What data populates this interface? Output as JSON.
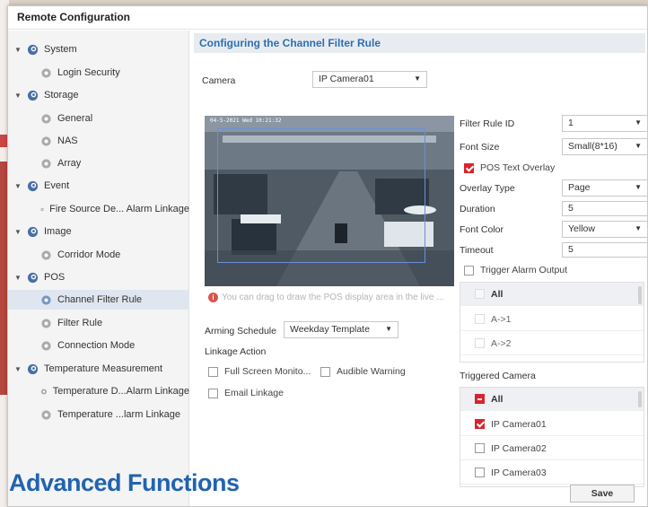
{
  "window": {
    "title": "Remote Configuration"
  },
  "sidebar": {
    "items": [
      {
        "label": "System",
        "level": 0,
        "expanded": true,
        "icon": "gear-group-icon"
      },
      {
        "label": "Login Security",
        "level": 1,
        "icon": "gear-icon"
      },
      {
        "label": "Storage",
        "level": 0,
        "expanded": true,
        "icon": "gear-group-icon"
      },
      {
        "label": "General",
        "level": 1,
        "icon": "gear-icon"
      },
      {
        "label": "NAS",
        "level": 1,
        "icon": "gear-icon"
      },
      {
        "label": "Array",
        "level": 1,
        "icon": "gear-icon"
      },
      {
        "label": "Event",
        "level": 0,
        "expanded": true,
        "icon": "gear-group-icon"
      },
      {
        "label": "Fire Source De... Alarm Linkage",
        "level": 1,
        "icon": "gear-icon"
      },
      {
        "label": "Image",
        "level": 0,
        "expanded": true,
        "icon": "gear-group-icon"
      },
      {
        "label": "Corridor Mode",
        "level": 1,
        "icon": "gear-icon"
      },
      {
        "label": "POS",
        "level": 0,
        "expanded": true,
        "icon": "gear-group-icon"
      },
      {
        "label": "Channel Filter Rule",
        "level": 1,
        "selected": true,
        "icon": "gear-icon"
      },
      {
        "label": "Filter Rule",
        "level": 1,
        "icon": "gear-icon"
      },
      {
        "label": "Connection Mode",
        "level": 1,
        "icon": "gear-icon"
      },
      {
        "label": "Temperature Measurement",
        "level": 0,
        "expanded": true,
        "icon": "gear-group-icon"
      },
      {
        "label": "Temperature D...Alarm Linkage",
        "level": 1,
        "icon": "gear-icon"
      },
      {
        "label": "Temperature ...larm Linkage",
        "level": 1,
        "icon": "gear-icon"
      }
    ]
  },
  "main": {
    "section_title": "Configuring the Channel Filter Rule",
    "camera_label": "Camera",
    "camera_value": "IP Camera01",
    "video_osd": "04-5-2021 Wed 10:21:32",
    "draw_hint": "You can drag to draw the POS display area in the live ...",
    "arming_schedule_label": "Arming Schedule",
    "arming_schedule_value": "Weekday Template",
    "linkage_action_label": "Linkage Action",
    "linkage": {
      "full_screen": "Full Screen Monito...",
      "audible_warning": "Audible Warning",
      "email_linkage": "Email Linkage"
    },
    "settings": {
      "filter_rule_id_label": "Filter Rule ID",
      "filter_rule_id_value": "1",
      "font_size_label": "Font Size",
      "font_size_value": "Small(8*16)",
      "pos_text_overlay_label": "POS Text Overlay",
      "pos_text_overlay_checked": true,
      "overlay_type_label": "Overlay Type",
      "overlay_type_value": "Page",
      "duration_label": "Duration",
      "duration_value": "5",
      "font_color_label": "Font Color",
      "font_color_value": "Yellow",
      "timeout_label": "Timeout",
      "timeout_value": "5",
      "trigger_alarm_output_label": "Trigger Alarm Output"
    },
    "alarm_outputs": {
      "all_label": "All",
      "items": [
        "A->1",
        "A->2"
      ]
    },
    "triggered_camera": {
      "label": "Triggered Camera",
      "all_label": "All",
      "items": [
        {
          "name": "IP Camera01",
          "checked": true
        },
        {
          "name": "IP Camera02",
          "checked": false
        },
        {
          "name": "IP Camera03",
          "checked": false
        }
      ]
    },
    "save_label": "Save"
  },
  "watermark": "Advanced Functions",
  "colors": {
    "accent": "#2f6fb0",
    "check": "#d9232d",
    "watermark": "#2163b0"
  }
}
